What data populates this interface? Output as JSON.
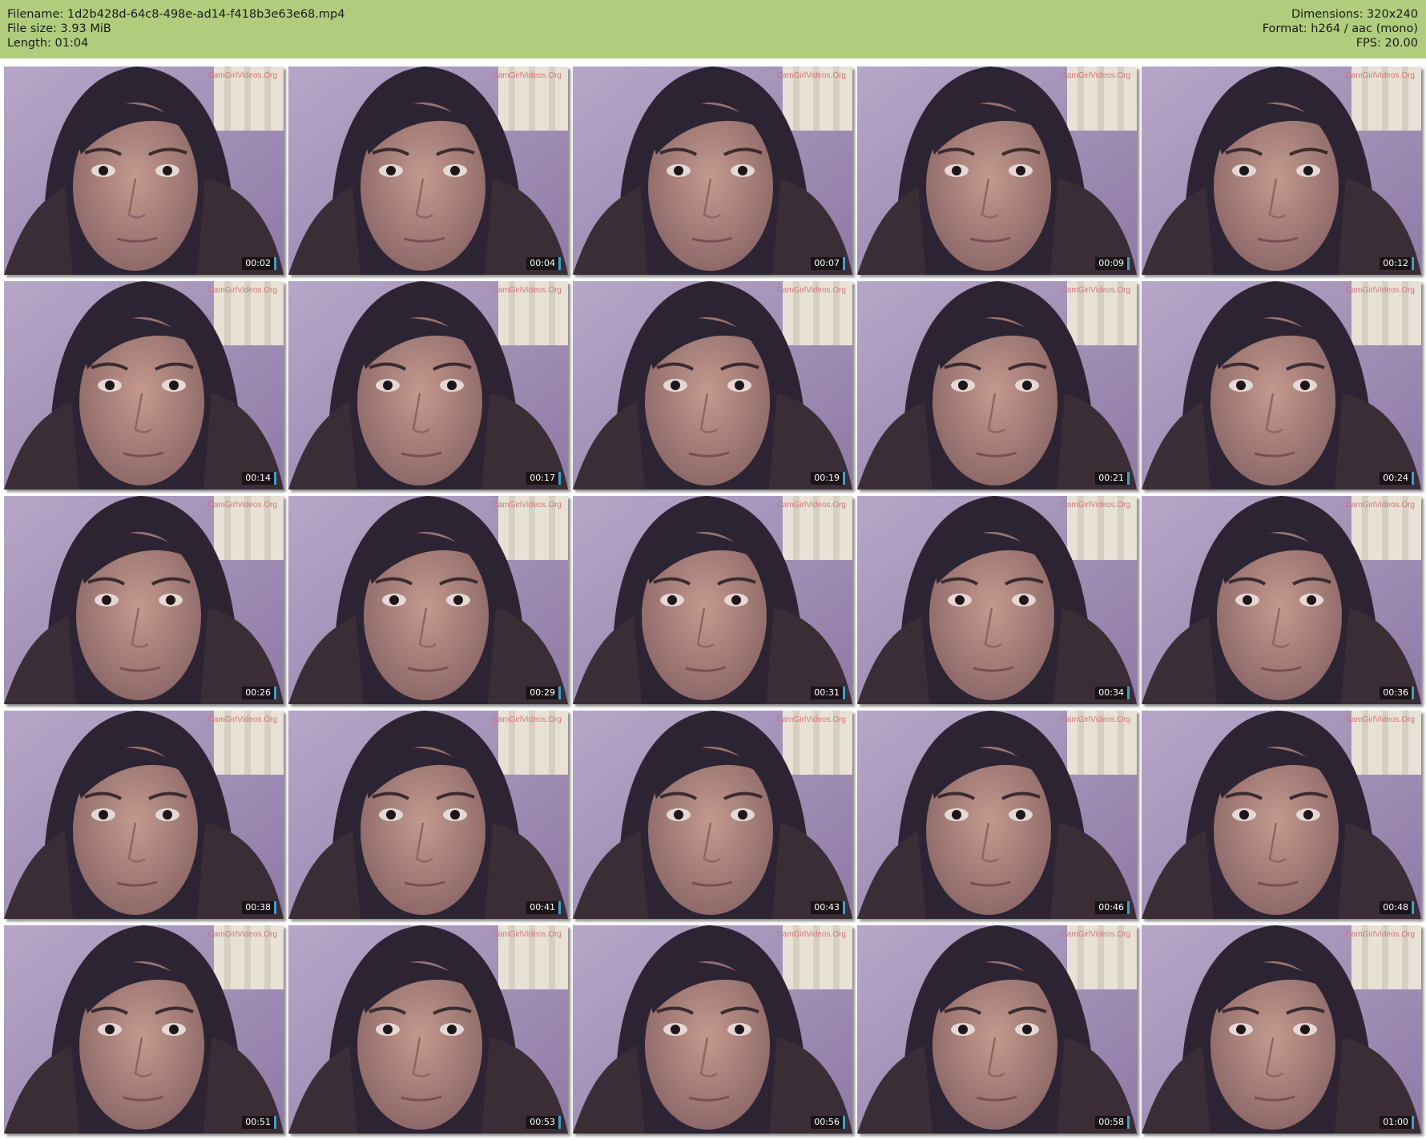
{
  "header": {
    "filename": "Filename: 1d2b428d-64c8-498e-ad14-f418b3e63e68.mp4",
    "filesize": "File size: 3.93 MiB",
    "length": "Length: 01:04",
    "dimensions": "Dimensions: 320x240",
    "format": "Format: h264 / aac (mono)",
    "fps": "FPS: 20.00"
  },
  "watermark": "CamGirlVideos.Org",
  "timestamps": [
    "00:02",
    "00:04",
    "00:07",
    "00:09",
    "00:12",
    "00:14",
    "00:17",
    "00:19",
    "00:21",
    "00:24",
    "00:26",
    "00:29",
    "00:31",
    "00:34",
    "00:36",
    "00:38",
    "00:41",
    "00:43",
    "00:46",
    "00:48",
    "00:51",
    "00:53",
    "00:56",
    "00:58",
    "01:00"
  ],
  "colors": {
    "header_bg": "#b0cd7e",
    "background_purple": "#a08eb4",
    "hair": "#2a2230",
    "skin": "#b88f86",
    "timestamp_accent": "#3f9fc8"
  }
}
